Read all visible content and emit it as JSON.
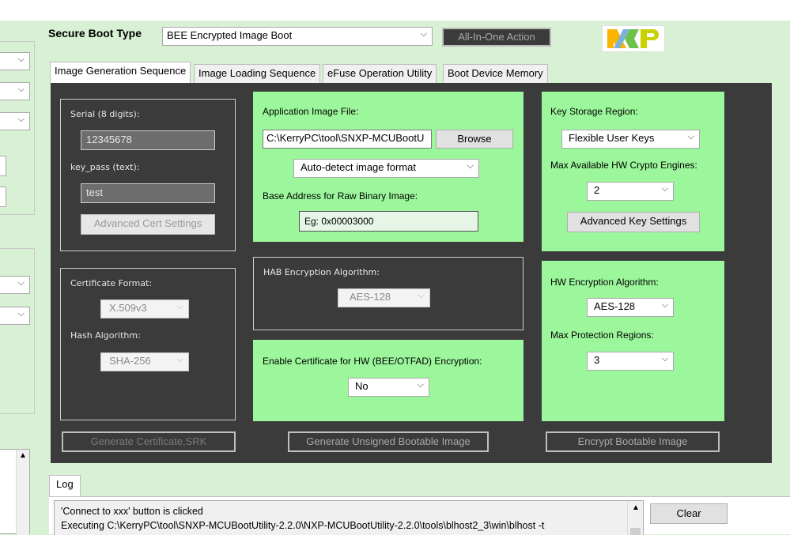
{
  "header": {
    "secure_boot_type_label": "Secure Boot Type",
    "secure_boot_type_value": "BEE Encrypted Image Boot",
    "all_in_one_label": "All-In-One Action",
    "logo_text": "NXP"
  },
  "tabs": [
    {
      "label": "Image Generation Sequence"
    },
    {
      "label": "Image Loading Sequence"
    },
    {
      "label": "eFuse Operation Utility"
    },
    {
      "label": "Boot Device Memory"
    }
  ],
  "cert_group": {
    "serial_label": "Serial (8 digits):",
    "serial_value": "12345678",
    "keypass_label": "key_pass (text):",
    "keypass_value": "test",
    "advanced_cert_label": "Advanced Cert Settings"
  },
  "app_group": {
    "file_label": "Application Image File:",
    "file_value": "C:\\KerryPC\\tool\\SNXP-MCUBootU",
    "browse_label": "Browse",
    "format_value": "Auto-detect image format",
    "base_addr_label": "Base Address for Raw Binary Image:",
    "base_addr_placeholder": "Eg: 0x00003000"
  },
  "key_group": {
    "storage_label": "Key Storage Region:",
    "storage_value": "Flexible User Keys",
    "engines_label": "Max Available HW Crypto Engines:",
    "engines_value": "2",
    "advanced_key_label": "Advanced Key Settings"
  },
  "cert_format_group": {
    "format_label": "Certificate Format:",
    "format_value": "X.509v3",
    "hash_label": "Hash Algorithm:",
    "hash_value": "SHA-256"
  },
  "hab_group": {
    "label": "HAB Encryption Algorithm:",
    "value": "AES-128"
  },
  "enable_cert_group": {
    "label": "Enable Certificate for HW (BEE/OTFAD) Encryption:",
    "value": "No"
  },
  "hw_enc_group": {
    "algo_label": "HW Encryption Algorithm:",
    "algo_value": "AES-128",
    "regions_label": "Max Protection Regions:",
    "regions_value": "3"
  },
  "actions": {
    "gen_cert_label": "Generate Certificate,SRK",
    "gen_unsigned_label": "Generate Unsigned Bootable Image",
    "encrypt_label": "Encrypt Bootable Image"
  },
  "log": {
    "tab_label": "Log",
    "line1": "'Connect to xxx' button is clicked",
    "line2": "Executing C:\\KerryPC\\tool\\SNXP-MCUBootUtility-2.2.0\\NXP-MCUBootUtility-2.2.0\\tools\\blhost2_3\\win\\blhost -t",
    "clear_label": "Clear"
  },
  "colors": {
    "green_panel": "#9cf79c",
    "dark_panel": "#3b3b3b",
    "background": "#d8f0d3"
  }
}
